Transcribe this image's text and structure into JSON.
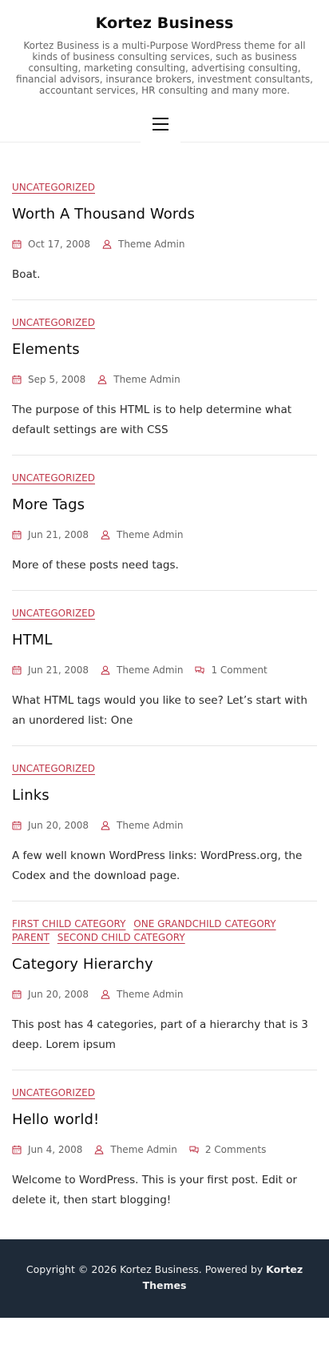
{
  "site": {
    "title": "Kortez Business",
    "description": "Kortez Business is a multi-Purpose WordPress theme for all kinds of business consulting services, such as business consulting, marketing consulting, advertising consulting, financial advisors, insurance brokers, investment consultants, accountant services, HR consulting and many more."
  },
  "nav": {
    "toggle_icon": "hamburger-menu-icon"
  },
  "colors": {
    "accent": "#c0394b",
    "footer_bg": "#1e2a38",
    "text": "#2b2b2b",
    "meta": "#666666"
  },
  "posts": [
    {
      "categories": [
        "UNCATEGORIZED"
      ],
      "title": "Worth A Thousand Words",
      "date": "Oct 17, 2008",
      "author": "Theme Admin",
      "comments": "",
      "excerpt": "Boat."
    },
    {
      "categories": [
        "UNCATEGORIZED"
      ],
      "title": "Elements",
      "date": "Sep 5, 2008",
      "author": "Theme Admin",
      "comments": "",
      "excerpt": "The purpose of this HTML is to help determine what default settings are with CSS"
    },
    {
      "categories": [
        "UNCATEGORIZED"
      ],
      "title": "More Tags",
      "date": "Jun 21, 2008",
      "author": "Theme Admin",
      "comments": "",
      "excerpt": "More of these posts need tags."
    },
    {
      "categories": [
        "UNCATEGORIZED"
      ],
      "title": "HTML",
      "date": "Jun 21, 2008",
      "author": "Theme Admin",
      "comments": "1 Comment",
      "excerpt": "What HTML tags would you like to see? Let’s start with an unordered list: One"
    },
    {
      "categories": [
        "UNCATEGORIZED"
      ],
      "title": "Links",
      "date": "Jun 20, 2008",
      "author": "Theme Admin",
      "comments": "",
      "excerpt": "A few well known WordPress links: WordPress.org, the Codex and the download page."
    },
    {
      "categories": [
        "FIRST CHILD CATEGORY",
        "ONE GRANDCHILD CATEGORY",
        "PARENT",
        "SECOND CHILD CATEGORY"
      ],
      "title": "Category Hierarchy",
      "date": "Jun 20, 2008",
      "author": "Theme Admin",
      "comments": "",
      "excerpt": "This post has 4 categories, part of a hierarchy that is 3 deep. Lorem ipsum"
    },
    {
      "categories": [
        "UNCATEGORIZED"
      ],
      "title": "Hello world!",
      "date": "Jun 4, 2008",
      "author": "Theme Admin",
      "comments": "2 Comments",
      "excerpt": "Welcome to WordPress. This is your first post. Edit or delete it, then start blogging!"
    }
  ],
  "footer": {
    "copyright": "Copyright © 2026 Kortez Business. Powered by",
    "powered_link": "Kortez Themes"
  }
}
